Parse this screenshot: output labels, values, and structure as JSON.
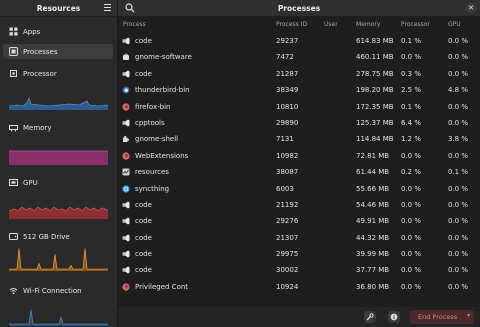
{
  "sidebar": {
    "title": "Resources",
    "items": [
      {
        "label": "Apps",
        "icon": "apps-icon"
      },
      {
        "label": "Processes",
        "icon": "processes-icon"
      },
      {
        "label": "Processor",
        "icon": "processor-icon"
      },
      {
        "label": "Memory",
        "icon": "memory-icon"
      },
      {
        "label": "GPU",
        "icon": "gpu-icon"
      },
      {
        "label": "512 GB Drive",
        "icon": "drive-icon"
      },
      {
        "label": "Wi-Fi Connection",
        "icon": "wifi-icon"
      }
    ]
  },
  "main": {
    "title": "Processes",
    "columns": {
      "process": "Process",
      "pid": "Process ID",
      "user": "User",
      "memory": "Memory",
      "processor": "Processor",
      "gpu": "GPU"
    },
    "rows": [
      {
        "name": "code",
        "pid": "29237",
        "memory": "614.83 MB",
        "processor": "0.1 %",
        "gpu": "0.0 %",
        "icon": "vscode-icon"
      },
      {
        "name": "gnome-software",
        "pid": "7472",
        "memory": "460.11 MB",
        "processor": "0.0 %",
        "gpu": "0.0 %",
        "icon": "software-icon"
      },
      {
        "name": "code",
        "pid": "21287",
        "memory": "278.75 MB",
        "processor": "0.3 %",
        "gpu": "0.0 %",
        "icon": "vscode-icon"
      },
      {
        "name": "thunderbird-bin",
        "pid": "38349",
        "memory": "198.20 MB",
        "processor": "2.5 %",
        "gpu": "4.8 %",
        "icon": "thunderbird-icon"
      },
      {
        "name": "firefox-bin",
        "pid": "10810",
        "memory": "172.35 MB",
        "processor": "0.1 %",
        "gpu": "0.0 %",
        "icon": "firefox-icon"
      },
      {
        "name": "cpptools",
        "pid": "29890",
        "memory": "125.37 MB",
        "processor": "6.4 %",
        "gpu": "0.0 %",
        "icon": "vscode-icon"
      },
      {
        "name": "gnome-shell",
        "pid": "7131",
        "memory": "114.84 MB",
        "processor": "1.2 %",
        "gpu": "3.8 %",
        "icon": "puzzle-icon"
      },
      {
        "name": "WebExtensions",
        "pid": "10982",
        "memory": "72.81 MB",
        "processor": "0.0 %",
        "gpu": "0.0 %",
        "icon": "firefox-icon"
      },
      {
        "name": "resources",
        "pid": "38087",
        "memory": "61.44 MB",
        "processor": "0.2 %",
        "gpu": "0.1 %",
        "icon": "resources-icon"
      },
      {
        "name": "syncthing",
        "pid": "6003",
        "memory": "55.66 MB",
        "processor": "0.0 %",
        "gpu": "0.0 %",
        "icon": "syncthing-icon"
      },
      {
        "name": "code",
        "pid": "21192",
        "memory": "54.46 MB",
        "processor": "0.0 %",
        "gpu": "0.0 %",
        "icon": "vscode-icon"
      },
      {
        "name": "code",
        "pid": "29276",
        "memory": "49.91 MB",
        "processor": "0.0 %",
        "gpu": "0.0 %",
        "icon": "vscode-icon"
      },
      {
        "name": "code",
        "pid": "21307",
        "memory": "44.32 MB",
        "processor": "0.0 %",
        "gpu": "0.0 %",
        "icon": "vscode-icon"
      },
      {
        "name": "code",
        "pid": "29975",
        "memory": "39.99 MB",
        "processor": "0.0 %",
        "gpu": "0.0 %",
        "icon": "vscode-icon"
      },
      {
        "name": "code",
        "pid": "30002",
        "memory": "37.77 MB",
        "processor": "0.0 %",
        "gpu": "0.0 %",
        "icon": "vscode-icon"
      },
      {
        "name": "Privileged Cont",
        "pid": "10924",
        "memory": "36.80 MB",
        "processor": "0.0 %",
        "gpu": "0.0 %",
        "icon": "firefox-icon"
      }
    ],
    "end_button_label": "End Process"
  },
  "colors": {
    "processor_graph": "#3a7bbf",
    "memory_graph": "#b64a94",
    "gpu_graph": "#c0484b",
    "drive_graph": "#e0902a"
  }
}
